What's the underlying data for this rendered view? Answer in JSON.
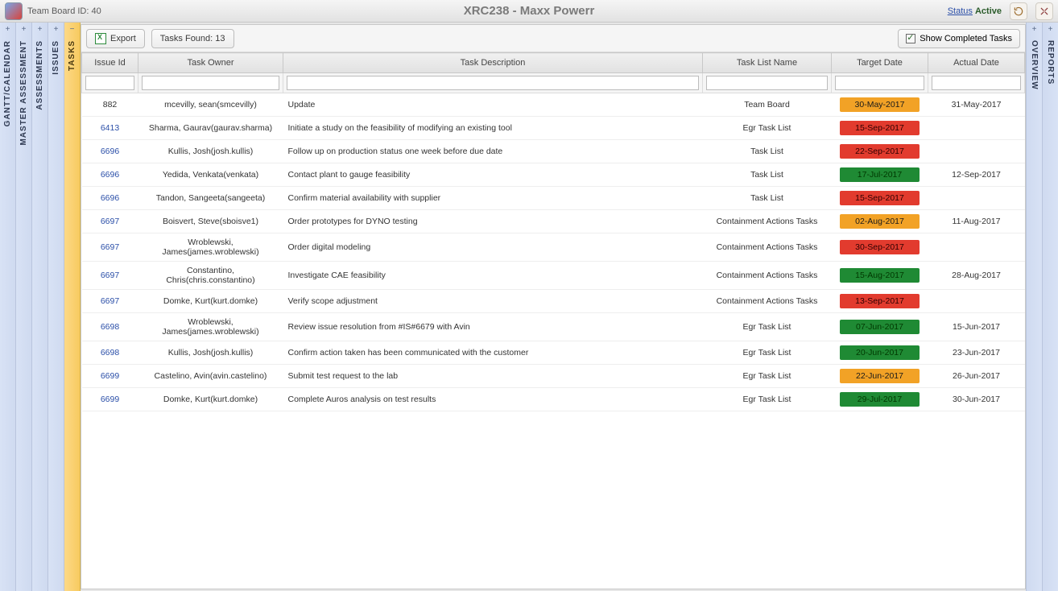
{
  "header": {
    "board_id_label": "Team Board ID: 40",
    "title": "XRC238 - Maxx Powerr",
    "status_label": "Status",
    "status_value": "Active"
  },
  "left_tabs": [
    {
      "id": "gantt",
      "label": "GANTT/CALENDAR",
      "toggle": "+"
    },
    {
      "id": "master",
      "label": "MASTER ASSESSMENT",
      "toggle": "+"
    },
    {
      "id": "assess",
      "label": "ASSESSMENTS",
      "toggle": "+"
    },
    {
      "id": "issues",
      "label": "ISSUES",
      "toggle": "+"
    },
    {
      "id": "tasks",
      "label": "TASKS",
      "toggle": "−",
      "active": true
    }
  ],
  "right_tabs": [
    {
      "id": "overview",
      "label": "OVERVIEW",
      "toggle": "+"
    },
    {
      "id": "reports",
      "label": "REPORTS",
      "toggle": "+"
    }
  ],
  "toolbar": {
    "export_label": "Export",
    "found_label": "Tasks Found: 13",
    "show_completed_label": "Show Completed Tasks"
  },
  "columns": {
    "issue": "Issue Id",
    "owner": "Task Owner",
    "desc": "Task Description",
    "list": "Task List Name",
    "target": "Target Date",
    "actual": "Actual Date"
  },
  "rows": [
    {
      "issue": "882",
      "link": false,
      "owner": "mcevilly, sean(smcevilly)",
      "desc": "Update",
      "list": "Team Board",
      "target": "30-May-2017",
      "tclass": "orange",
      "actual": "31-May-2017"
    },
    {
      "issue": "6413",
      "link": true,
      "owner": "Sharma, Gaurav(gaurav.sharma)",
      "desc": "Initiate a study on the feasibility of modifying an existing tool",
      "list": "Egr Task List",
      "target": "15-Sep-2017",
      "tclass": "red",
      "actual": ""
    },
    {
      "issue": "6696",
      "link": true,
      "owner": "Kullis, Josh(josh.kullis)",
      "desc": "Follow up on production status one week before due date",
      "list": "Task List",
      "target": "22-Sep-2017",
      "tclass": "red",
      "actual": ""
    },
    {
      "issue": "6696",
      "link": true,
      "owner": "Yedida, Venkata(venkata)",
      "desc": "Contact plant to gauge feasibility",
      "list": "Task List",
      "target": "17-Jul-2017",
      "tclass": "green",
      "actual": "12-Sep-2017"
    },
    {
      "issue": "6696",
      "link": true,
      "owner": "Tandon, Sangeeta(sangeeta)",
      "desc": "Confirm material availability with supplier",
      "list": "Task List",
      "target": "15-Sep-2017",
      "tclass": "red",
      "actual": ""
    },
    {
      "issue": "6697",
      "link": true,
      "owner": "Boisvert, Steve(sboisve1)",
      "desc": "Order prototypes for DYNO testing",
      "list": "Containment Actions Tasks",
      "target": "02-Aug-2017",
      "tclass": "orange",
      "actual": "11-Aug-2017"
    },
    {
      "issue": "6697",
      "link": true,
      "owner": "Wroblewski, James(james.wroblewski)",
      "desc": "Order digital modeling",
      "list": "Containment Actions Tasks",
      "target": "30-Sep-2017",
      "tclass": "red",
      "actual": ""
    },
    {
      "issue": "6697",
      "link": true,
      "owner": "Constantino, Chris(chris.constantino)",
      "desc": "Investigate CAE feasibility",
      "list": "Containment Actions Tasks",
      "target": "15-Aug-2017",
      "tclass": "green",
      "actual": "28-Aug-2017"
    },
    {
      "issue": "6697",
      "link": true,
      "owner": "Domke, Kurt(kurt.domke)",
      "desc": "Verify scope adjustment",
      "list": "Containment Actions Tasks",
      "target": "13-Sep-2017",
      "tclass": "red",
      "actual": ""
    },
    {
      "issue": "6698",
      "link": true,
      "owner": "Wroblewski, James(james.wroblewski)",
      "desc": "Review issue resolution from #IS#6679 with Avin",
      "list": "Egr Task List",
      "target": "07-Jun-2017",
      "tclass": "green",
      "actual": "15-Jun-2017"
    },
    {
      "issue": "6698",
      "link": true,
      "owner": "Kullis, Josh(josh.kullis)",
      "desc": "Confirm action taken has been communicated with the customer",
      "list": "Egr Task List",
      "target": "20-Jun-2017",
      "tclass": "green",
      "actual": "23-Jun-2017"
    },
    {
      "issue": "6699",
      "link": true,
      "owner": "Castelino, Avin(avin.castelino)",
      "desc": "Submit test request to the lab",
      "list": "Egr Task List",
      "target": "22-Jun-2017",
      "tclass": "orange",
      "actual": "26-Jun-2017"
    },
    {
      "issue": "6699",
      "link": true,
      "owner": "Domke, Kurt(kurt.domke)",
      "desc": "Complete Auros analysis on test results",
      "list": "Egr Task List",
      "target": "29-Jul-2017",
      "tclass": "green",
      "actual": "30-Jun-2017"
    }
  ]
}
